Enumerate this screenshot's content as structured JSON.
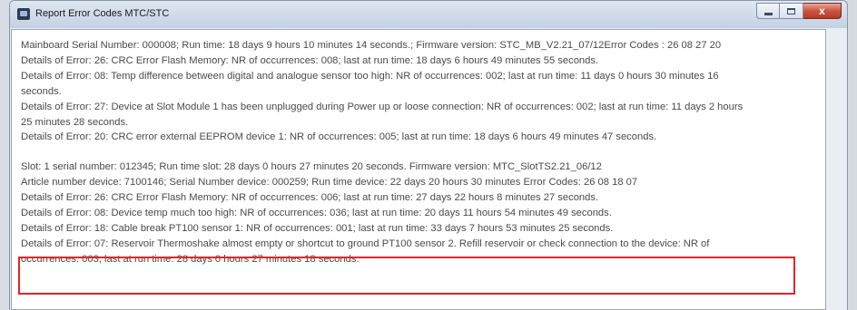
{
  "window": {
    "title": "Report Error Codes MTC/STC",
    "icon": "app-icon",
    "buttons": {
      "minimize": "minimize",
      "maximize": "maximize",
      "close": "x"
    }
  },
  "mainboard": [
    "Mainboard Serial Number: 000008;  Run time: 18 days 9 hours 10 minutes 14 seconds.;  Firmware version: STC_MB_V2.21_07/12Error Codes :  26 08 27 20",
    "Details of Error: 26: CRC Error Flash Memory: NR of occurrences: 008; last at run time: 18 days 6 hours 49 minutes 55 seconds.",
    "Details of Error: 08: Temp difference between digital and analogue sensor too high: NR of occurrences: 002; last at run time: 11 days 0 hours 30 minutes 16",
    "seconds.",
    "Details of Error: 27: Device at Slot Module 1 has been unplugged during Power up or loose connection: NR of occurrences: 002; last at run time: 11 days 2 hours",
    "25 minutes 28 seconds.",
    "Details of Error: 20: CRC error external EEPROM device 1: NR of occurrences: 005; last at run time: 18 days 6 hours 49 minutes 47 seconds."
  ],
  "slot": [
    "Slot: 1 serial number: 012345; Run time slot: 28 days 0 hours 27 minutes 20 seconds. Firmware version: MTC_SlotTS2.21_06/12",
    "Article number device: 7100146; Serial Number device: 000259; Run time device: 22 days 20 hours 30 minutes Error Codes:  26 08 18 07",
    "Details of Error: 26: CRC Error Flash Memory: NR of occurrences: 006; last at run time: 27 days 22 hours 8 minutes 27 seconds.",
    "Details of Error: 08: Device temp much too high: NR of occurrences: 036; last at run time: 20 days 11 hours 54 minutes 49 seconds.",
    "Details of Error: 18: Cable break PT100 sensor 1: NR of occurrences: 001; last at run time: 33 days 7 hours 53 minutes 25 seconds.",
    "Details of Error: 07: Reservoir Thermoshake almost empty or shortcut to ground PT100 sensor 2. Refill reservoir or check connection to the device: NR of",
    "occurrences: 003; last at run time: 28 days 0 hours 27 minutes 18 seconds."
  ],
  "colors": {
    "highlight_border": "#e0262a",
    "text": "#4a4a4a",
    "close_button": "#c9543e"
  }
}
